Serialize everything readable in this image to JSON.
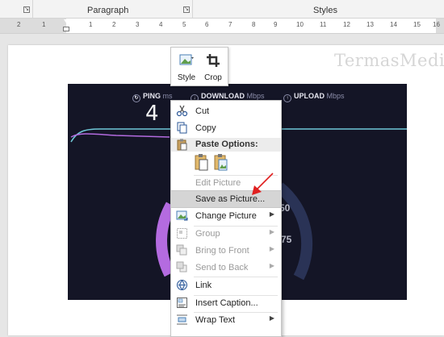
{
  "ribbon": {
    "paragraph_label": "Paragraph",
    "styles_label": "Styles"
  },
  "ruler": {
    "numbers": [
      "2",
      "1",
      "1",
      "2",
      "3",
      "4",
      "5",
      "6",
      "7",
      "8",
      "9",
      "10",
      "11",
      "12",
      "13",
      "14",
      "15",
      "16"
    ]
  },
  "watermark": "TermasMedia",
  "speedtest": {
    "ping_label": "PING",
    "ping_unit": "ms",
    "ping_value": "4",
    "download_label": "DOWNLOAD",
    "download_unit": "Mbps",
    "upload_label": "UPLOAD",
    "upload_unit": "Mbps",
    "gauge_50": "50",
    "gauge_75": "75",
    "colors": {
      "background": "#141526",
      "download_line": "#6fc8d8",
      "upload_line": "#b46be0",
      "gauge": "#2a3356"
    }
  },
  "mini_toolbar": {
    "style_label": "Style",
    "crop_label": "Crop"
  },
  "context_menu": {
    "items": [
      {
        "label": "Cut",
        "icon": "scissors-icon",
        "disabled": false
      },
      {
        "label": "Copy",
        "icon": "copy-icon",
        "disabled": false
      },
      {
        "label": "Paste Options:",
        "icon": "paste-icon",
        "header": true
      },
      {
        "label": "Edit Picture",
        "disabled": true
      },
      {
        "label": "Save as Picture...",
        "highlighted": true
      },
      {
        "label": "Change Picture",
        "icon": "change-picture-icon",
        "submenu": true
      },
      {
        "label": "Group",
        "icon": "group-icon",
        "disabled": true,
        "submenu": true
      },
      {
        "label": "Bring to Front",
        "icon": "bring-front-icon",
        "disabled": true,
        "submenu": true
      },
      {
        "label": "Send to Back",
        "icon": "send-back-icon",
        "disabled": true,
        "submenu": true
      },
      {
        "label": "Link",
        "icon": "link-icon"
      },
      {
        "label": "Insert Caption...",
        "icon": "caption-icon"
      },
      {
        "label": "Wrap Text",
        "icon": "wrap-text-icon",
        "submenu": true
      }
    ]
  },
  "accent": {
    "arrow": "#e02020",
    "highlight": "#d5d5d5"
  }
}
